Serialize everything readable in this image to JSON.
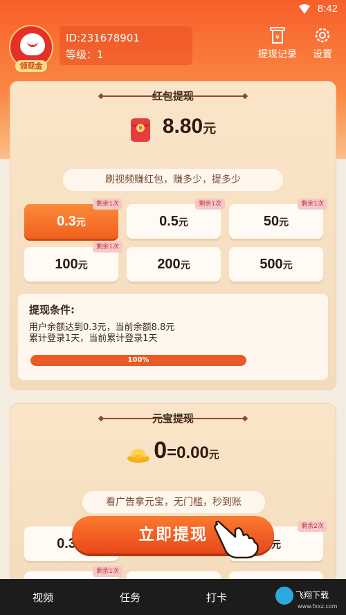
{
  "status_bar": {
    "time": "8:42"
  },
  "user": {
    "id_text": "ID:231678901",
    "level_text": "等级：1",
    "avatar_tag": "领现金"
  },
  "header_actions": {
    "withdraw_record": "提现记录",
    "settings": "设置"
  },
  "red_packet": {
    "title": "红包提现",
    "balance": "8.80",
    "unit": "元",
    "slogan": "刷视频赚红包，赚多少，提多少",
    "options": [
      {
        "amount": "0.3",
        "unit": "元",
        "badge": "剩余1次",
        "selected": true
      },
      {
        "amount": "0.5",
        "unit": "元",
        "badge": "剩余1次",
        "selected": false
      },
      {
        "amount": "50",
        "unit": "元",
        "badge": "剩余1次",
        "selected": false
      },
      {
        "amount": "100",
        "unit": "元",
        "badge": "剩余1次",
        "selected": false
      },
      {
        "amount": "200",
        "unit": "元",
        "badge": "",
        "selected": false
      },
      {
        "amount": "500",
        "unit": "元",
        "badge": "",
        "selected": false
      }
    ],
    "conditions": {
      "title": "提现条件:",
      "line1": "用户余额达到0.3元，当前余额8.8元",
      "line2": "累计登录1天，当前累计登录1天",
      "progress_label": "100%",
      "progress_value": 1.0
    }
  },
  "ingot": {
    "title": "元宝提现",
    "count": "0",
    "equals": "=0.00",
    "unit": "元",
    "slogan": "看广告拿元宝，无门槛，秒到账",
    "options_visible": [
      {
        "amount": "0.3",
        "unit": "元",
        "badge": ""
      },
      {
        "amount": "",
        "unit": "元",
        "badge": "剩余2次"
      }
    ],
    "lower_badge": "剩余1次"
  },
  "withdraw_button": "立即提现",
  "bottom_nav": {
    "items": [
      "视频",
      "任务",
      "打卡"
    ]
  },
  "watermark": {
    "text": "飞翔下载",
    "url": "www.fxxz.com"
  },
  "colors": {
    "accent": "#f2611e",
    "header": "#f85f2a",
    "card": "#fbe5c8"
  }
}
